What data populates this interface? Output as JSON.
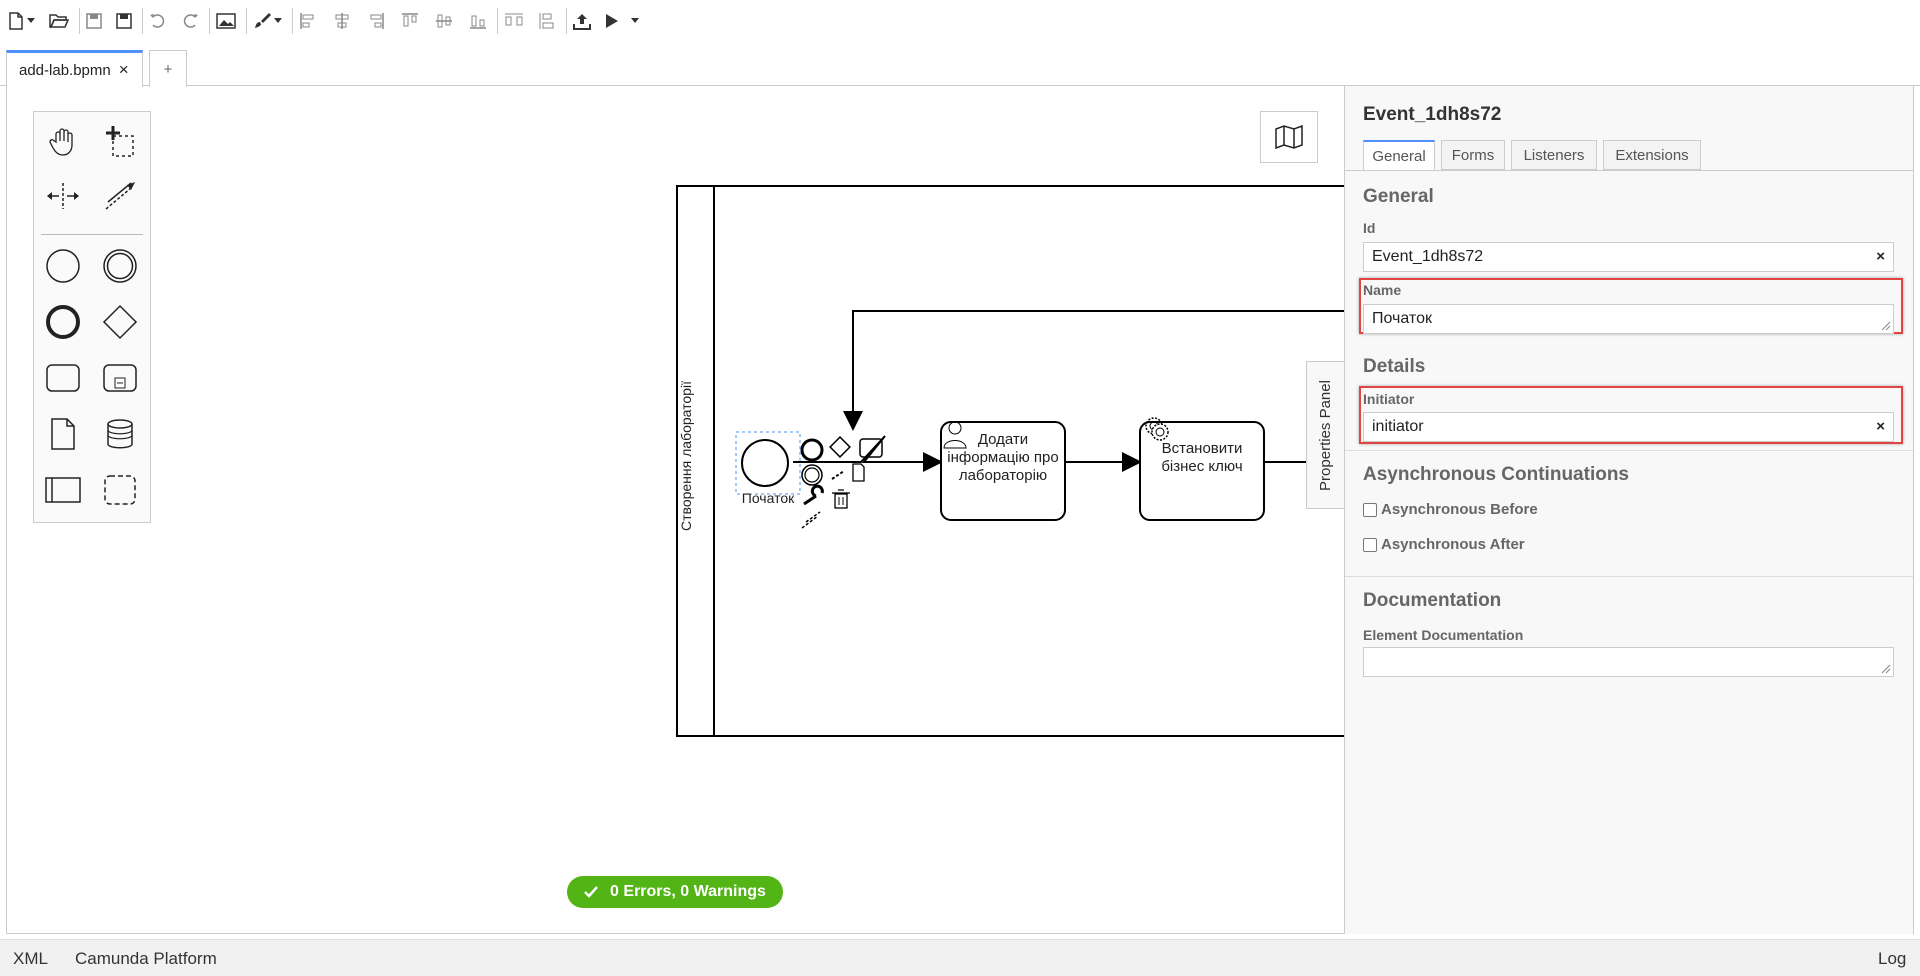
{
  "toolbar": {
    "buttons": [
      "new-file",
      "open-file",
      "save",
      "save-as",
      "undo",
      "redo",
      "export-image",
      "color-picker",
      "align-left",
      "align-center",
      "align-right",
      "align-top",
      "align-middle",
      "align-bottom",
      "distribute-horizontal",
      "distribute-vertical",
      "deploy",
      "start-instance"
    ]
  },
  "tabs": {
    "file": "add-lab.bpmn",
    "close": "×",
    "add": "+"
  },
  "diagram": {
    "lane_label": "Створення лабораторії",
    "start_event_label": "Початок",
    "user_task_label": "Додати інформацію про лабораторію",
    "user_task_lines": [
      "Додати",
      "інформацію про",
      "лабораторію"
    ],
    "service_task_label": "Встановити бізнес ключ",
    "service_task_lines": [
      "Встановити",
      "бізнес ключ"
    ]
  },
  "status": {
    "text": "0 Errors, 0 Warnings",
    "color": "#52b415"
  },
  "properties_toggle": "Properties Panel",
  "properties": {
    "title": "Event_1dh8s72",
    "tabs": [
      "General",
      "Forms",
      "Listeners",
      "Extensions"
    ],
    "general": {
      "section": "General",
      "id_label": "Id",
      "id_value": "Event_1dh8s72",
      "name_label": "Name",
      "name_value": "Початок"
    },
    "details": {
      "section": "Details",
      "initiator_label": "Initiator",
      "initiator_value": "initiator"
    },
    "async": {
      "section": "Asynchronous Continuations",
      "before": "Asynchronous Before",
      "after": "Asynchronous After"
    },
    "documentation": {
      "section": "Documentation",
      "label": "Element Documentation",
      "value": ""
    },
    "clear_symbol": "×",
    "highlight_color": "#e04545"
  },
  "footer": {
    "xml": "XML",
    "platform": "Camunda Platform",
    "log": "Log"
  }
}
